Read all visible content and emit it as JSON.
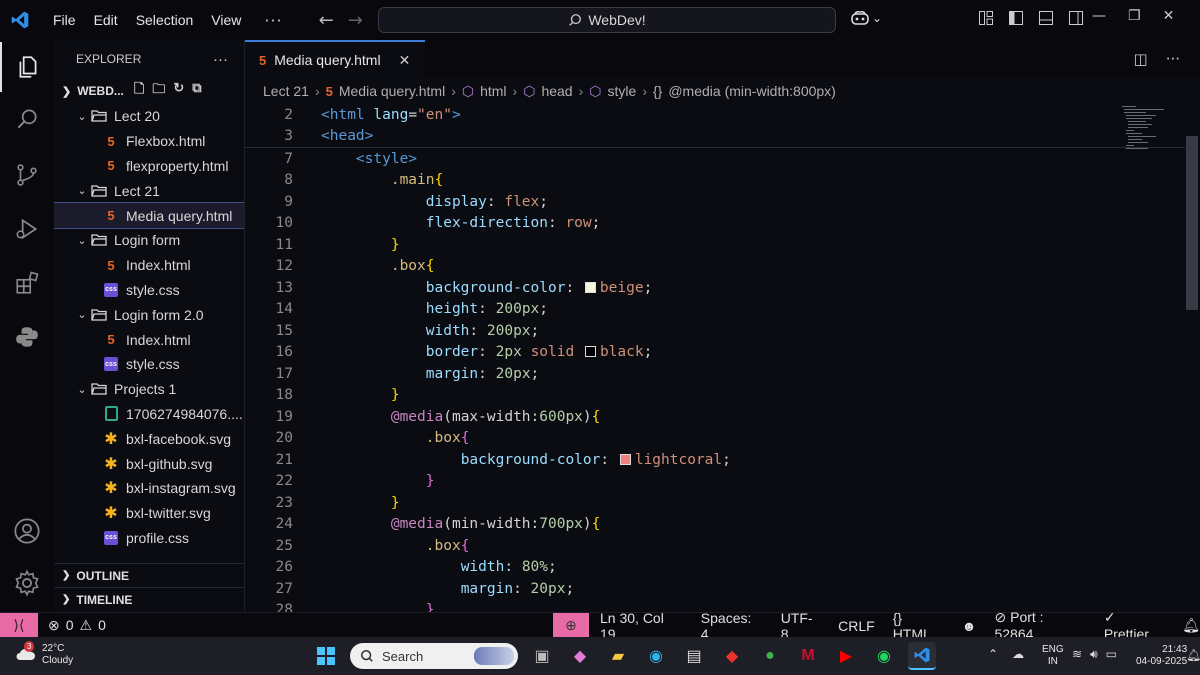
{
  "titlebar": {
    "menu": [
      "File",
      "Edit",
      "Selection",
      "View"
    ],
    "more": "···",
    "search_label": "WebDev!"
  },
  "explorer": {
    "title": "EXPLORER",
    "more": "···",
    "workspace": "WEBD...",
    "tree": [
      {
        "kind": "folder",
        "label": "Lect 20",
        "depth": 1
      },
      {
        "kind": "html",
        "label": "Flexbox.html",
        "depth": 2
      },
      {
        "kind": "html",
        "label": "flexproperty.html",
        "depth": 2
      },
      {
        "kind": "folder",
        "label": "Lect 21",
        "depth": 1
      },
      {
        "kind": "html",
        "label": "Media query.html",
        "depth": 2,
        "selected": true
      },
      {
        "kind": "folder",
        "label": "Login form",
        "depth": 1
      },
      {
        "kind": "html",
        "label": "Index.html",
        "depth": 2
      },
      {
        "kind": "css",
        "label": "style.css",
        "depth": 2
      },
      {
        "kind": "folder",
        "label": "Login form 2.0",
        "depth": 1
      },
      {
        "kind": "html",
        "label": "Index.html",
        "depth": 2
      },
      {
        "kind": "css",
        "label": "style.css",
        "depth": 2
      },
      {
        "kind": "folder",
        "label": "Projects 1",
        "depth": 1
      },
      {
        "kind": "image",
        "label": "1706274984076....",
        "depth": 2
      },
      {
        "kind": "svg",
        "label": "bxl-facebook.svg",
        "depth": 2
      },
      {
        "kind": "svg",
        "label": "bxl-github.svg",
        "depth": 2
      },
      {
        "kind": "svg",
        "label": "bxl-instagram.svg",
        "depth": 2
      },
      {
        "kind": "svg",
        "label": "bxl-twitter.svg",
        "depth": 2
      },
      {
        "kind": "css",
        "label": "profile.css",
        "depth": 2
      }
    ],
    "outline": "OUTLINE",
    "timeline": "TIMELINE"
  },
  "editor": {
    "tab_label": "Media query.html",
    "breadcrumbs": [
      "Lect 21",
      "Media query.html",
      "html",
      "head",
      "style",
      "@media (min-width:800px)"
    ],
    "swatch_colors": {
      "beige": "#f5f5dc",
      "black": "#000000",
      "lightcoral": "#f08080"
    }
  },
  "status": {
    "errors": "0",
    "warnings": "0",
    "position": "Ln 30, Col 19",
    "spaces": "Spaces: 4",
    "encoding": "UTF-8",
    "eol": "CRLF",
    "language": "HTML",
    "port": "Port : 52864",
    "prettier": "Prettier"
  },
  "taskbar": {
    "weather_temp": "22°C",
    "weather_desc": "Cloudy",
    "weather_badge": "3",
    "search_placeholder": "Search",
    "lang_top": "ENG",
    "lang_bottom": "IN",
    "time": "21:43",
    "date": "04-09-2025"
  },
  "colors": {
    "accent": "#3a7bd5",
    "remote": "#e86aa6",
    "background": "#0b0b12"
  }
}
